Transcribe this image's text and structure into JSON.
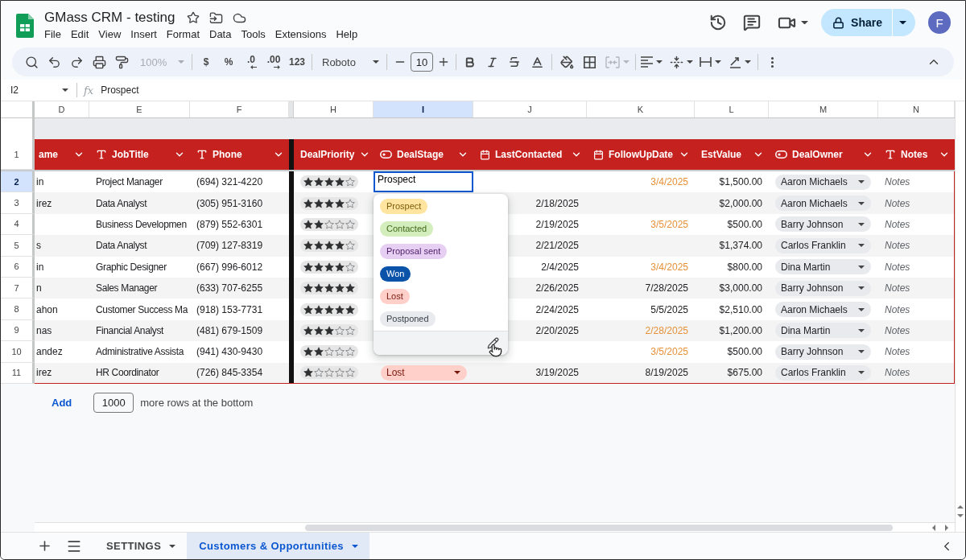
{
  "document": {
    "title": "GMass CRM - testing"
  },
  "menu": [
    "File",
    "Edit",
    "View",
    "Insert",
    "Format",
    "Data",
    "Tools",
    "Extensions",
    "Help"
  ],
  "header": {
    "share": "Share",
    "avatar": "F"
  },
  "toolbar": {
    "zoom": "100%",
    "zoom_disabled": true,
    "currency": "$",
    "percent": "%",
    "decimals_less": ".0",
    "decimals_more": ".00",
    "number_format": "123",
    "font": "Roboto",
    "font_size": "10",
    "merge_disabled": true
  },
  "formula_bar": {
    "cell": "I2",
    "fx": "fx",
    "value": "Prospect"
  },
  "columns": [
    {
      "letter": "D",
      "selected": false
    },
    {
      "letter": "E",
      "selected": false
    },
    {
      "letter": "F",
      "selected": false
    },
    {
      "letter": "H",
      "selected": false
    },
    {
      "letter": "I",
      "selected": true
    },
    {
      "letter": "J",
      "selected": false
    },
    {
      "letter": "K",
      "selected": false
    },
    {
      "letter": "L",
      "selected": false
    },
    {
      "letter": "M",
      "selected": false
    },
    {
      "letter": "N",
      "selected": false
    }
  ],
  "table": {
    "header_row": "1",
    "headers": [
      {
        "label": "ame",
        "kind": "plain"
      },
      {
        "label": "JobTitle",
        "kind": "text"
      },
      {
        "label": "Phone",
        "kind": "text"
      },
      {
        "label": "DealPriority",
        "kind": "plain"
      },
      {
        "label": "DealStage",
        "kind": "dropdown"
      },
      {
        "label": "LastContacted",
        "kind": "date"
      },
      {
        "label": "FollowUpDate",
        "kind": "date"
      },
      {
        "label": "EstValue",
        "kind": "plain"
      },
      {
        "label": "DealOwner",
        "kind": "dropdown"
      },
      {
        "label": "Notes",
        "kind": "text"
      }
    ],
    "rows": [
      {
        "number": "2",
        "selected": true,
        "name": "in",
        "job_title": "Project Manager",
        "phone": "(694) 321-4220",
        "stars": 4,
        "deal_stage": {
          "kind": "editor",
          "value": "Prospect"
        },
        "follow_up": {
          "value": "3/4/2025",
          "highlighted": true
        },
        "est_value": "$1,500.00",
        "owner": "Aaron Michaels",
        "notes": "Notes"
      },
      {
        "number": "3",
        "selected": false,
        "name": "irez",
        "job_title": "Data Analyst",
        "phone": "(305) 951-3160",
        "stars": 4,
        "last_contacted": "2/18/2025",
        "est_value": "$2,000.00",
        "owner": "Aaron Michaels",
        "notes": "Notes"
      },
      {
        "number": "4",
        "selected": false,
        "job_title": "Business Developmen",
        "phone": "(879) 552-6301",
        "stars": 2,
        "last_contacted": "2/19/2025",
        "follow_up": {
          "value": "3/5/2025",
          "highlighted": true
        },
        "est_value": "$500.00",
        "owner": "Barry Johnson",
        "notes": "Notes"
      },
      {
        "number": "5",
        "selected": false,
        "name": "s",
        "job_title": "Data Analyst",
        "phone": "(709) 127-8319",
        "stars": 4,
        "last_contacted": "2/21/2025",
        "est_value": "$1,374.00",
        "owner": "Carlos Franklin",
        "notes": "Notes"
      },
      {
        "number": "6",
        "selected": false,
        "name": "in",
        "job_title": "Graphic Designer",
        "phone": "(667) 996-6012",
        "stars": 4,
        "last_contacted": "2/4/2025",
        "follow_up": {
          "value": "3/4/2025",
          "highlighted": true
        },
        "est_value": "$800.00",
        "owner": "Dina Martin",
        "notes": "Notes"
      },
      {
        "number": "7",
        "selected": false,
        "name": "n",
        "job_title": "Sales Manager",
        "phone": "(633) 707-6255",
        "stars": 5,
        "last_contacted": "2/26/2025",
        "follow_up": {
          "value": "7/28/2025",
          "highlighted": false
        },
        "est_value": "$3,000.00",
        "owner": "Barry Johnson",
        "notes": "Notes"
      },
      {
        "number": "8",
        "selected": false,
        "name": "ahon",
        "job_title": "Customer Success Ma",
        "phone": "(918) 153-7731",
        "stars": 5,
        "last_contacted": "2/24/2025",
        "follow_up": {
          "value": "5/5/2025",
          "highlighted": false
        },
        "est_value": "$2,510.00",
        "owner": "Aaron Michaels",
        "notes": "Notes"
      },
      {
        "number": "9",
        "selected": false,
        "name": "nas",
        "job_title": "Financial Analyst",
        "phone": "(481) 679-1509",
        "stars": 3,
        "last_contacted": "2/20/2025",
        "follow_up": {
          "value": "2/28/2025",
          "highlighted": true
        },
        "est_value": "$1,200.00",
        "owner": "Dina Martin",
        "notes": "Notes"
      },
      {
        "number": "10",
        "selected": false,
        "name": "andez",
        "job_title": "Administrative Assista",
        "phone": "(941) 430-9430",
        "stars": 2,
        "follow_up": {
          "value": "3/5/2025",
          "highlighted": true
        },
        "est_value": "$500.00",
        "owner": "Barry Johnson",
        "notes": "Notes"
      },
      {
        "number": "11",
        "selected": false,
        "name": "irez",
        "job_title": "HR Coordinator",
        "phone": "(726) 845-3354",
        "stars": 1,
        "deal_stage": {
          "kind": "chip",
          "value": "Lost",
          "color": "#ffcfc9"
        },
        "last_contacted": "3/19/2025",
        "follow_up": {
          "value": "8/19/2025",
          "highlighted": false
        },
        "est_value": "$675.00",
        "owner": "Carlos Franklin",
        "notes": "Notes"
      }
    ]
  },
  "stage_dropdown": {
    "options": [
      {
        "label": "Prospect",
        "color": "#ffe5a0"
      },
      {
        "label": "Contacted",
        "color": "#d4edbc"
      },
      {
        "label": "Proposal sent",
        "color": "#e6cff2"
      },
      {
        "label": "Won",
        "color": "#0a53a8"
      },
      {
        "label": "Lost",
        "color": "#ffcfc9"
      },
      {
        "label": "Postponed",
        "color": "#e8eaed"
      }
    ]
  },
  "add_rows": {
    "link": "Add",
    "count": "1000",
    "suffix": "more rows at the bottom"
  },
  "sheet_tabs": [
    {
      "label": "SETTINGS",
      "selected": false
    },
    {
      "label": "Customers & Opportunities",
      "selected": true
    }
  ]
}
